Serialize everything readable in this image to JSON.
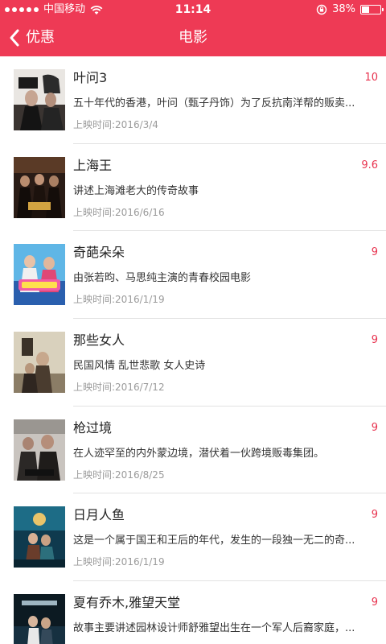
{
  "status_bar": {
    "carrier": "中国移动",
    "time": "11:14",
    "battery": "38%",
    "battery_level": 0.38
  },
  "nav": {
    "back_label": "优惠",
    "title": "电影"
  },
  "movies": [
    {
      "title": "叶问3",
      "score": "10",
      "desc": "五十年代的香港，叶问（甄子丹饰）为了反抗南洋帮的贩卖...",
      "date": "上映时间:2016/3/4"
    },
    {
      "title": "上海王",
      "score": "9.6",
      "desc": "讲述上海滩老大的传奇故事",
      "date": "上映时间:2016/6/16"
    },
    {
      "title": "奇葩朵朵",
      "score": "9",
      "desc": "由张若昀、马思纯主演的青春校园电影",
      "date": "上映时间:2016/1/19"
    },
    {
      "title": "那些女人",
      "score": "9",
      "desc": "民国风情 乱世悲歌 女人史诗",
      "date": "上映时间:2016/7/12"
    },
    {
      "title": "枪过境",
      "score": "9",
      "desc": "在人迹罕至的内外蒙边境，潜伏着一伙跨境贩毒集团。",
      "date": "上映时间:2016/8/25"
    },
    {
      "title": "日月人鱼",
      "score": "9",
      "desc": "这是一个属于国王和王后的年代，发生的一段独一无二的奇...",
      "date": "上映时间:2016/1/19"
    },
    {
      "title": "夏有乔木,雅望天堂",
      "score": "9",
      "desc": "故事主要讲述园林设计师舒雅望出生在一个军人后裔家庭，...",
      "date": ""
    }
  ]
}
